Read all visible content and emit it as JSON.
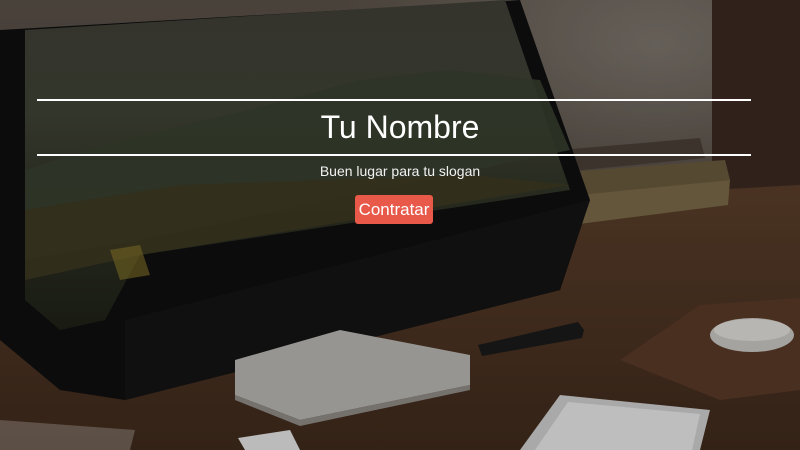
{
  "hero": {
    "title": "Tu Nombre",
    "slogan": "Buen lugar para tu slogan",
    "cta_label": "Contratar"
  },
  "colors": {
    "accent": "#e8594a",
    "text": "#ffffff",
    "overlay": "rgba(0,0,0,0.18)"
  },
  "background": {
    "description_icon": "desk-computer-photo"
  }
}
